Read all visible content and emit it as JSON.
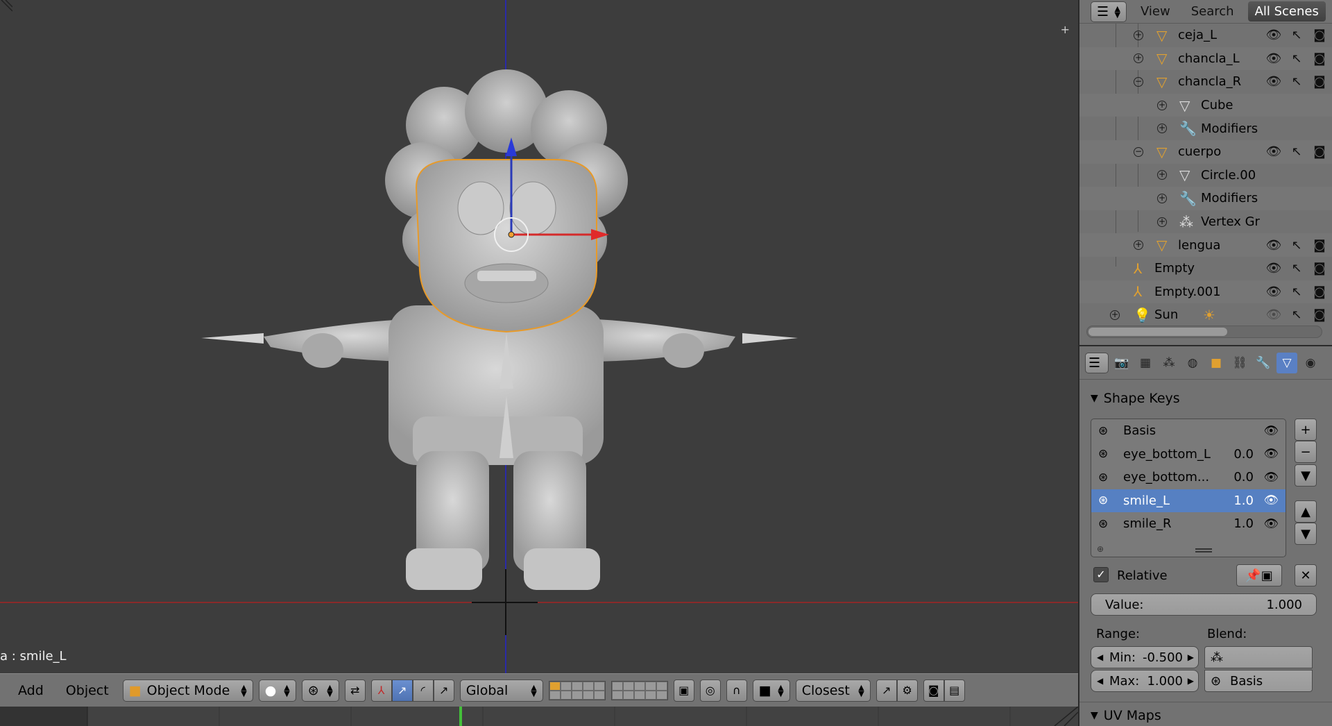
{
  "viewport": {
    "status_text": "a : smile_L",
    "header": {
      "add_label": "Add",
      "object_label": "Object",
      "mode_label": "Object Mode",
      "orientation_label": "Global",
      "snap_label": "Closest"
    }
  },
  "outliner": {
    "header": {
      "view_label": "View",
      "search_label": "Search",
      "scene_filter_label": "All Scenes"
    },
    "items": [
      {
        "name": "ceja_L"
      },
      {
        "name": "chancla_L"
      },
      {
        "name": "chancla_R"
      },
      {
        "name": "Cube"
      },
      {
        "name": "Modifiers"
      },
      {
        "name": "cuerpo"
      },
      {
        "name": "Circle.00"
      },
      {
        "name": "Modifiers"
      },
      {
        "name": "Vertex Gr"
      },
      {
        "name": "lengua"
      },
      {
        "name": "Empty"
      },
      {
        "name": "Empty.001"
      },
      {
        "name": "Sun"
      }
    ]
  },
  "properties": {
    "shape_keys_title": "Shape Keys",
    "shape_keys": [
      {
        "name": "Basis",
        "value": ""
      },
      {
        "name": "eye_bottom_L",
        "value": "0.0"
      },
      {
        "name": "eye_bottom...",
        "value": "0.0"
      },
      {
        "name": "smile_L",
        "value": "1.0"
      },
      {
        "name": "smile_R",
        "value": "1.0"
      }
    ],
    "relative_label": "Relative",
    "value_label": "Value:",
    "value_value": "1.000",
    "range_label": "Range:",
    "blend_label": "Blend:",
    "min_label": "Min:",
    "min_value": "-0.500",
    "max_label": "Max:",
    "max_value": "1.000",
    "blend_vgroup_value": "",
    "blend_basis_value": "Basis",
    "uv_maps_title": "UV Maps"
  }
}
